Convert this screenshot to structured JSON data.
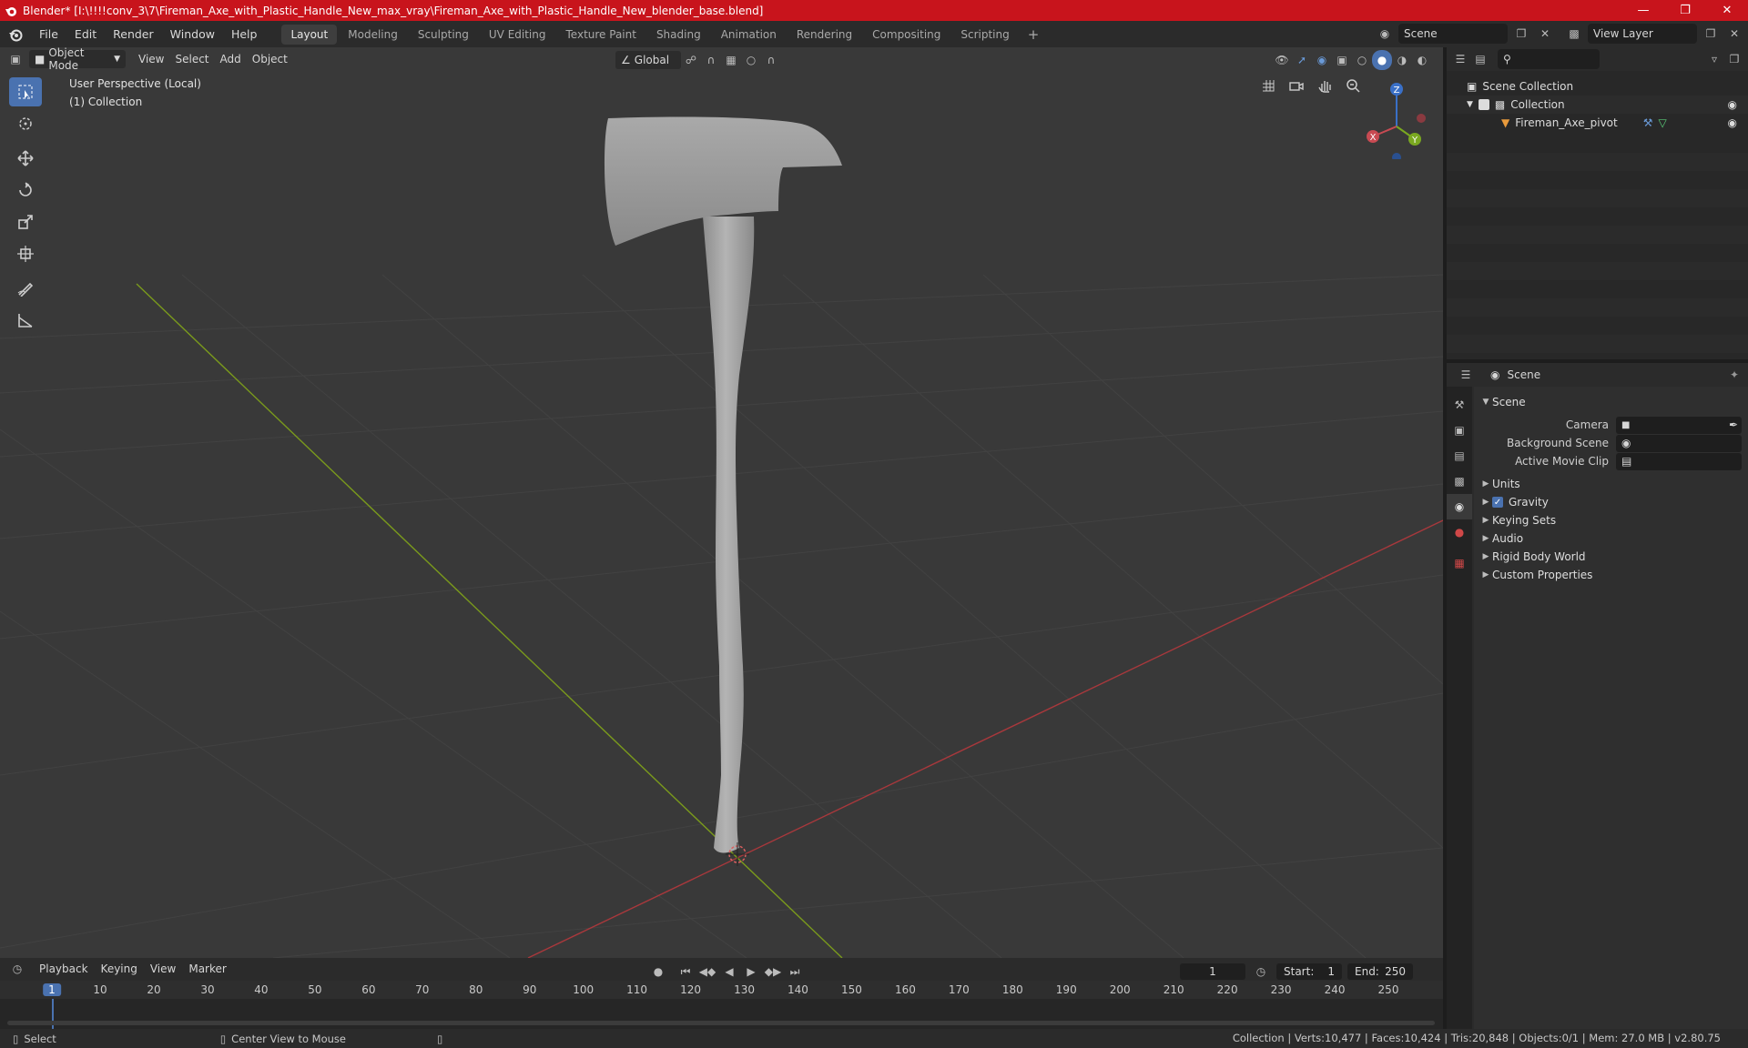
{
  "window": {
    "title": "Blender* [I:\\!!!!conv_3\\7\\Fireman_Axe_with_Plastic_Handle_New_max_vray\\Fireman_Axe_with_Plastic_Handle_New_blender_base.blend]"
  },
  "menu": [
    "File",
    "Edit",
    "Render",
    "Window",
    "Help"
  ],
  "workspaces": [
    {
      "label": "Layout",
      "active": true
    },
    {
      "label": "Modeling"
    },
    {
      "label": "Sculpting"
    },
    {
      "label": "UV Editing"
    },
    {
      "label": "Texture Paint"
    },
    {
      "label": "Shading"
    },
    {
      "label": "Animation"
    },
    {
      "label": "Rendering"
    },
    {
      "label": "Compositing"
    },
    {
      "label": "Scripting"
    }
  ],
  "topbar_right": {
    "scene": "Scene",
    "view_layer": "View Layer"
  },
  "viewport": {
    "mode": "Object Mode",
    "menus": [
      "View",
      "Select",
      "Add",
      "Object"
    ],
    "orientation": "Global",
    "info_line1": "User Perspective (Local)",
    "info_line2": "(1) Collection",
    "gizmo_axes": {
      "x": "X",
      "y": "Y",
      "z": "Z"
    }
  },
  "outliner": {
    "root": "Scene Collection",
    "collection": "Collection",
    "object": "Fireman_Axe_pivot"
  },
  "properties": {
    "header": "Scene",
    "section": "Scene",
    "fields": [
      {
        "label": "Camera"
      },
      {
        "label": "Background Scene"
      },
      {
        "label": "Active Movie Clip"
      }
    ],
    "panels": [
      "Units",
      "Gravity",
      "Keying Sets",
      "Audio",
      "Rigid Body World",
      "Custom Properties"
    ]
  },
  "timeline": {
    "menus": [
      "Playback",
      "Keying",
      "View",
      "Marker"
    ],
    "current_frame": "1",
    "start_label": "Start:",
    "start": "1",
    "end_label": "End:",
    "end": "250",
    "ruler": [
      "1",
      "10",
      "20",
      "30",
      "40",
      "50",
      "60",
      "70",
      "80",
      "90",
      "100",
      "110",
      "120",
      "130",
      "140",
      "150",
      "160",
      "170",
      "180",
      "190",
      "200",
      "210",
      "220",
      "230",
      "240",
      "250"
    ]
  },
  "statusbar": {
    "select": "Select",
    "center": "Center View to Mouse",
    "stats": "Collection | Verts:10,477 | Faces:10,424 | Tris:20,848 | Objects:0/1 | Mem: 27.0 MB | v2.80.75"
  },
  "colors": {
    "accent": "#4a72b0",
    "title_bar": "#c8141c",
    "x_axis": "#a8383c",
    "y_axis": "#7a9a1c"
  }
}
